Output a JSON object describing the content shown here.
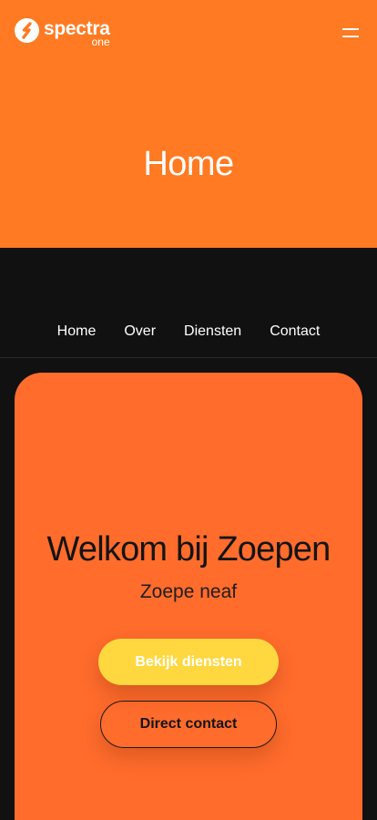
{
  "brand": {
    "name": "spectra",
    "sub": "one"
  },
  "header": {
    "title": "Home"
  },
  "nav": {
    "items": [
      {
        "label": "Home"
      },
      {
        "label": "Over"
      },
      {
        "label": "Diensten"
      },
      {
        "label": "Contact"
      }
    ]
  },
  "hero": {
    "title": "Welkom bij Zoepen",
    "subtitle": "Zoepe neaf",
    "primary_button": "Bekijk diensten",
    "secondary_button": "Direct contact"
  },
  "colors": {
    "header_bg": "#ff7a22",
    "page_bg": "#111111",
    "hero_bg": "#ff6c2c",
    "primary_button_bg": "#ffd840"
  },
  "icons": {
    "logo": "spectra-s-logo-icon",
    "menu": "hamburger-menu-icon"
  }
}
